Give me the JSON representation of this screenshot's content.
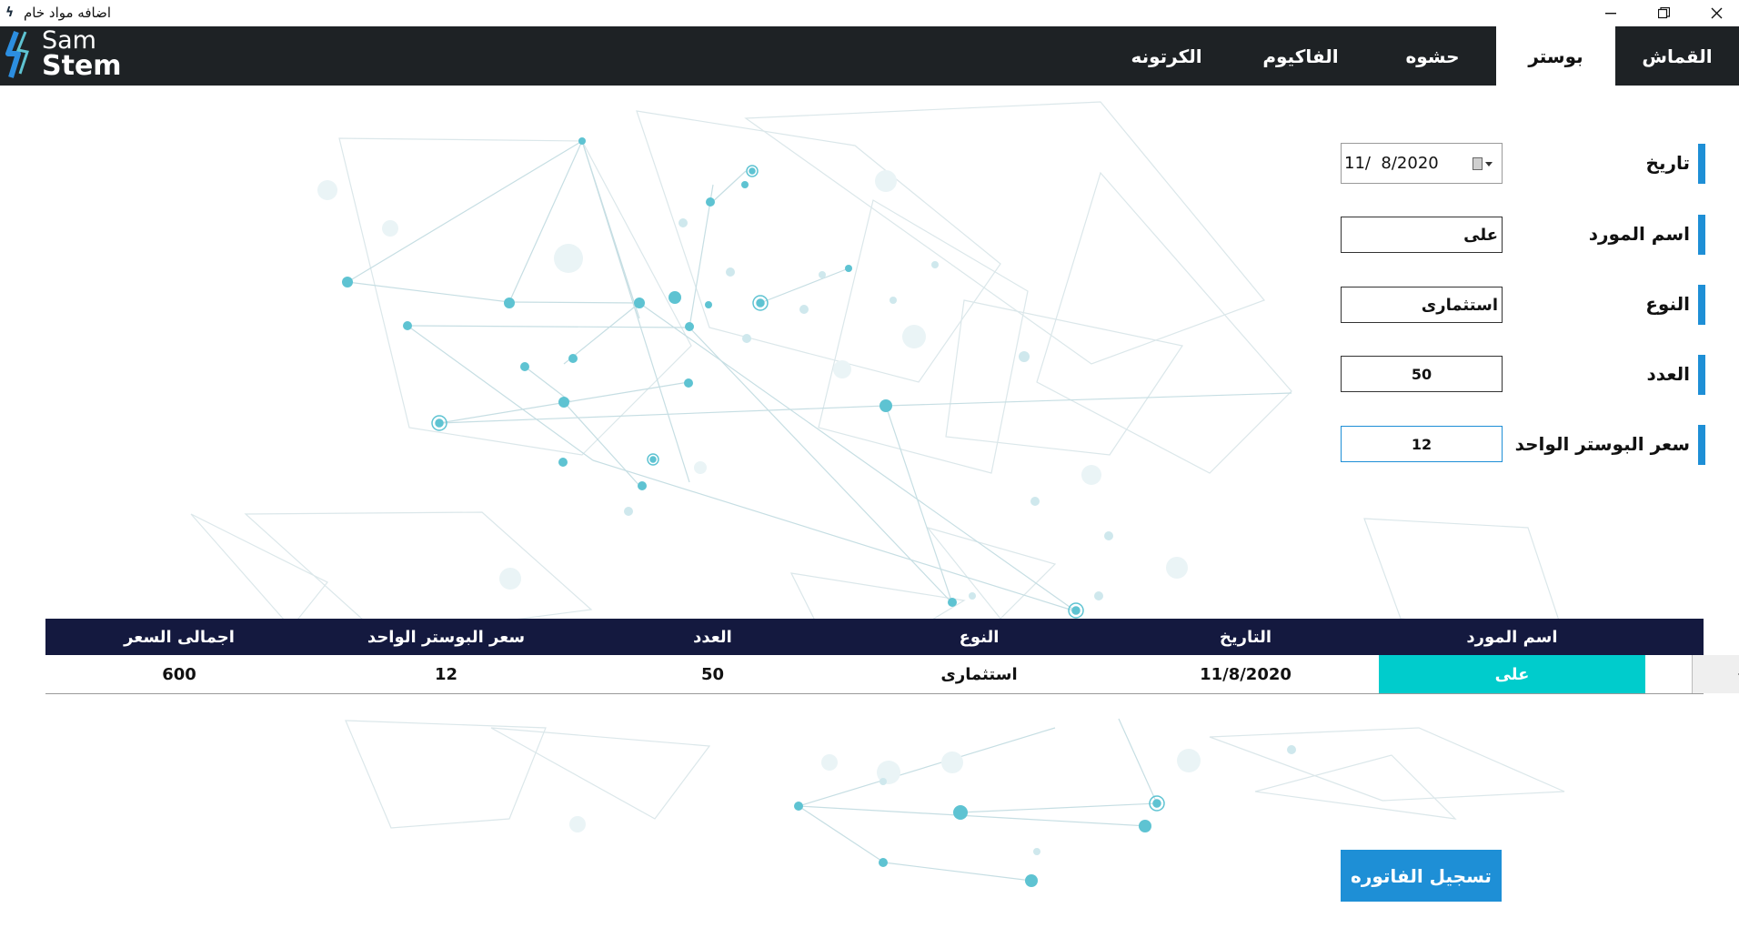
{
  "window": {
    "title": "اضافه مواد خام"
  },
  "logo": {
    "line1": "Sam",
    "line2": "Stem"
  },
  "tabs": [
    {
      "label": "القماش",
      "active": false
    },
    {
      "label": "بوستر",
      "active": true
    },
    {
      "label": "حشوه",
      "active": false
    },
    {
      "label": "الفاكيوم",
      "active": false
    },
    {
      "label": "الكرتونه",
      "active": false
    }
  ],
  "form": {
    "date": {
      "label": "تاريخ",
      "value": "11/  8/2020"
    },
    "supplier": {
      "label": "اسم المورد",
      "value": "على"
    },
    "type": {
      "label": "النوع",
      "value": "استثمارى"
    },
    "count": {
      "label": "العدد",
      "value": "50"
    },
    "unit_price": {
      "label": "سعر البوستر الواحد",
      "value": "12"
    }
  },
  "grid": {
    "columns": [
      "اسم المورد",
      "التاريخ",
      "النوع",
      "العدد",
      "سعر البوستر الواحد",
      "اجمالى السعر"
    ],
    "rows": [
      {
        "supplier": "على",
        "date": "11/8/2020",
        "type": "استثمارى",
        "count": "50",
        "unit_price": "12",
        "total": "600"
      }
    ]
  },
  "submit": {
    "label": "تسجيل الفاتوره"
  },
  "colors": {
    "nav": "#1e2225",
    "accent": "#1e8fd6",
    "grid_header": "#14193f",
    "selected": "#00cccc",
    "network": "#5ec3d2"
  }
}
